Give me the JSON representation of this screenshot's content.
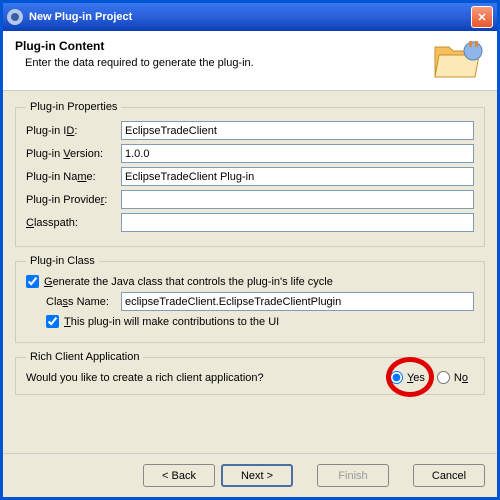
{
  "window": {
    "title": "New Plug-in Project"
  },
  "header": {
    "title": "Plug-in Content",
    "subtitle": "Enter the data required to generate the plug-in."
  },
  "props": {
    "legend": "Plug-in Properties",
    "id_label": "Plug-in ID:",
    "id_value": "EclipseTradeClient",
    "version_label": "Plug-in Version:",
    "version_value": "1.0.0",
    "name_label": "Plug-in Name:",
    "name_value": "EclipseTradeClient Plug-in",
    "provider_label": "Plug-in Provider:",
    "provider_value": "",
    "classpath_label": "Classpath:",
    "classpath_value": ""
  },
  "pclass": {
    "legend": "Plug-in Class",
    "generate_label": "Generate the Java class that controls the plug-in's life cycle",
    "classname_label": "Class Name:",
    "classname_value": "eclipseTradeClient.EclipseTradeClientPlugin",
    "contrib_label": "This plug-in will make contributions to the UI"
  },
  "rca": {
    "legend": "Rich Client Application",
    "question": "Would you like to create a rich client application?",
    "yes": "Yes",
    "no": "No"
  },
  "buttons": {
    "back": "< Back",
    "next": "Next >",
    "finish": "Finish",
    "cancel": "Cancel"
  }
}
